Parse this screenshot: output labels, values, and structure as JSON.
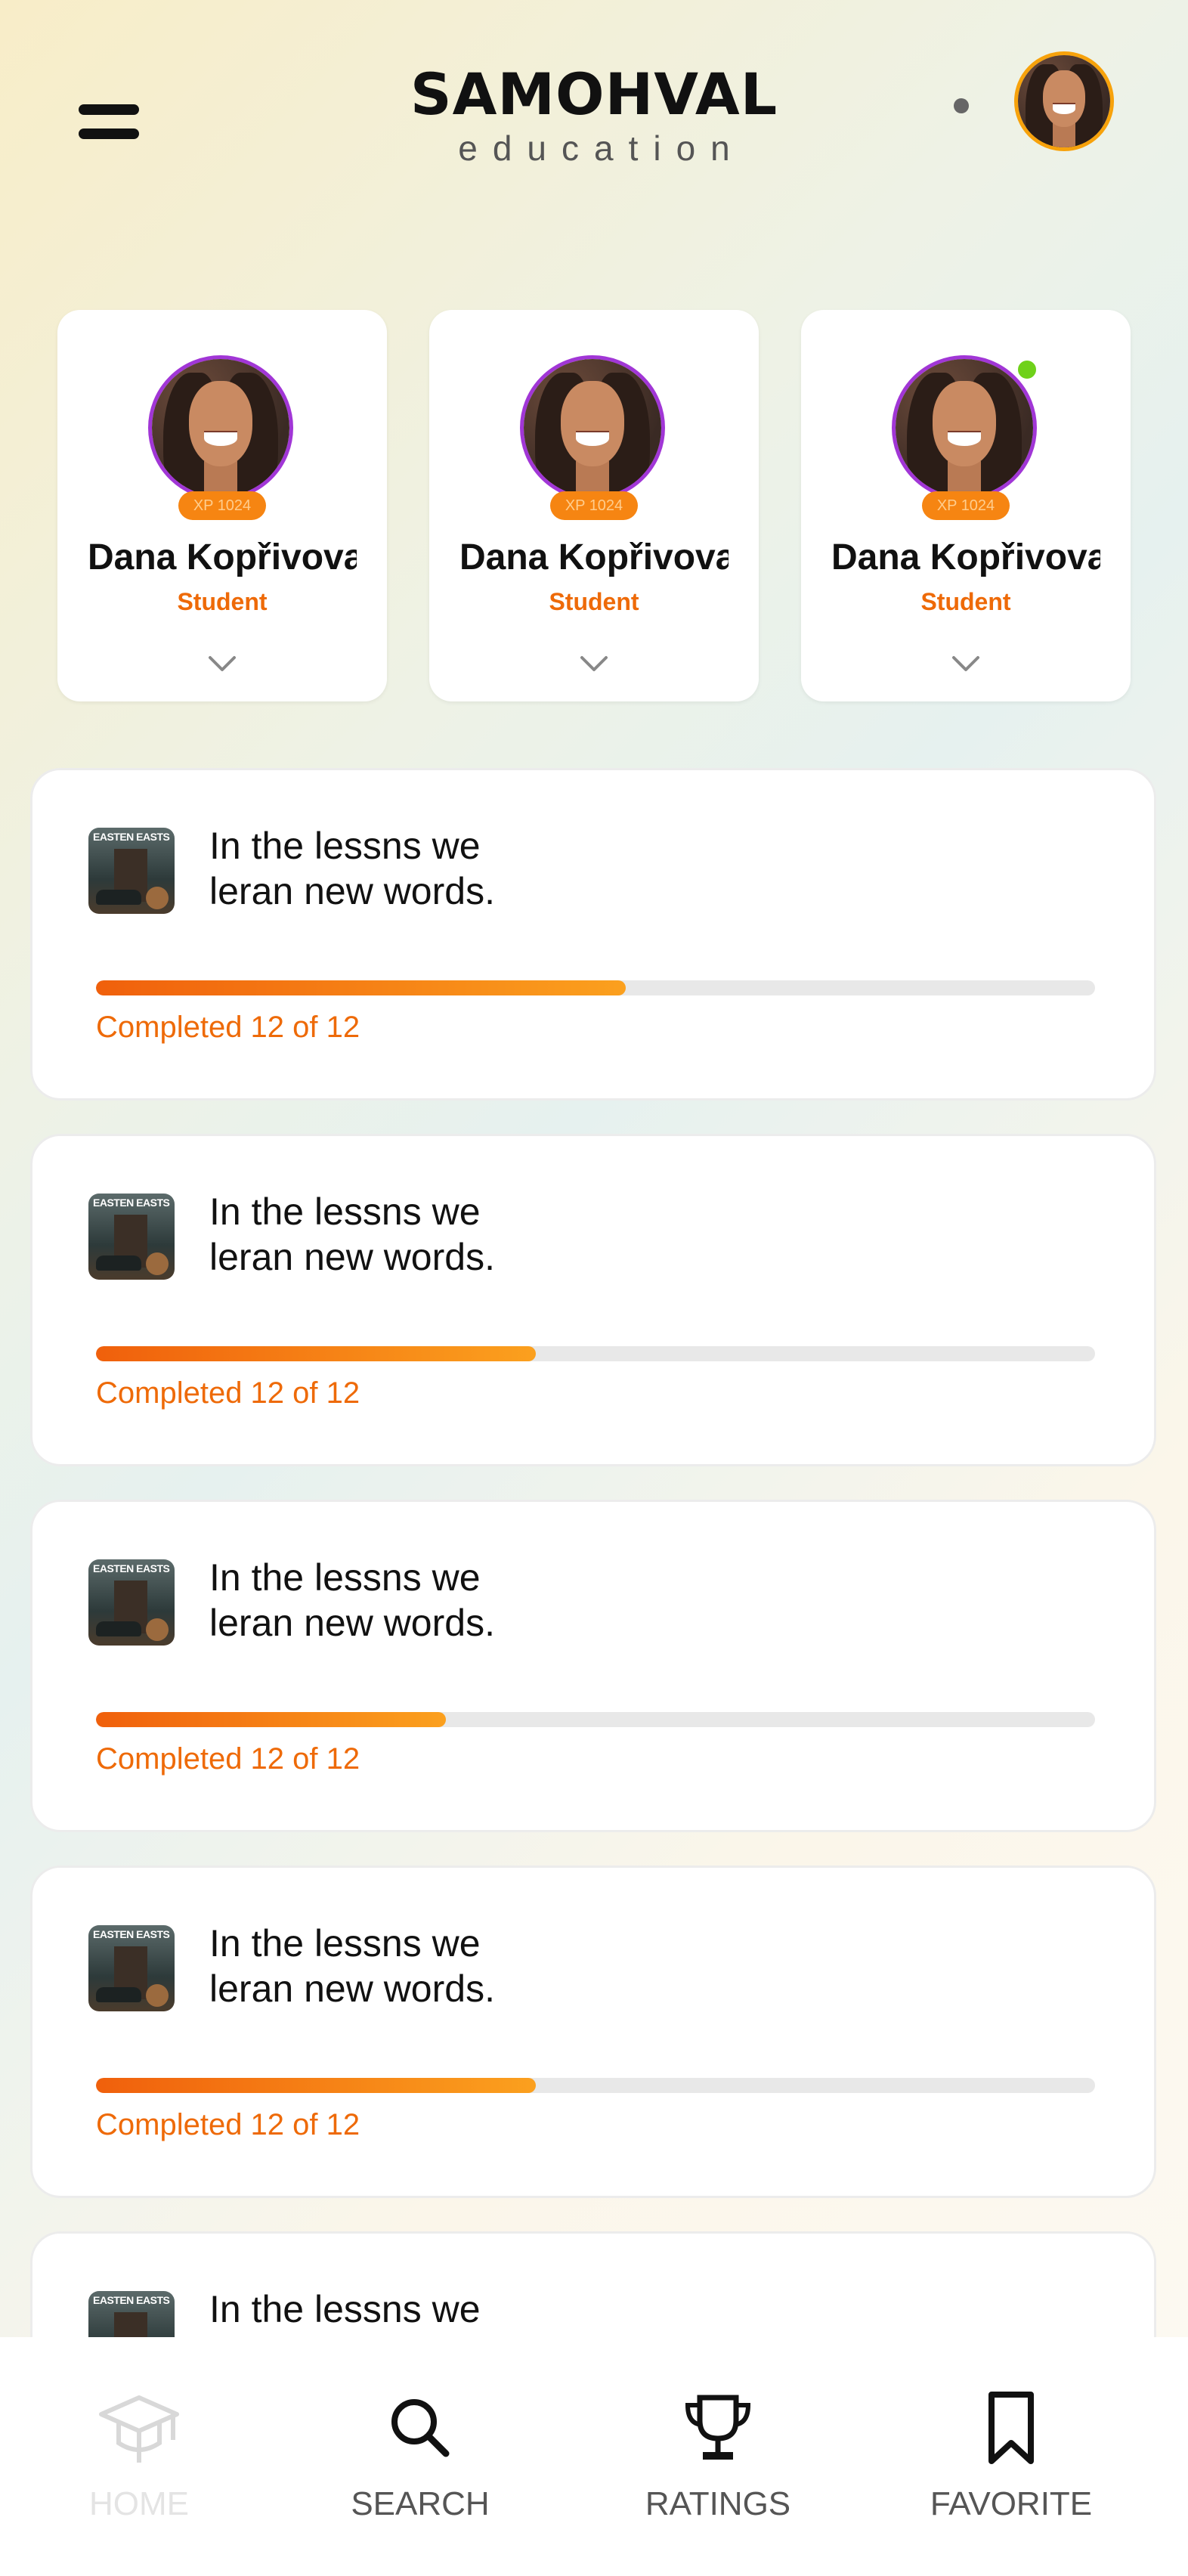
{
  "header": {
    "brand_name": "SAMOHVAL",
    "brand_sub": "education"
  },
  "profiles": [
    {
      "name": "Dana Kopřivova",
      "role": "Student",
      "xp": "XP 1024",
      "online": false
    },
    {
      "name": "Dana Kopřivova",
      "role": "Student",
      "xp": "XP 1024",
      "online": false
    },
    {
      "name": "Dana Kopřivova",
      "role": "Student",
      "xp": "XP 1024",
      "online": true
    }
  ],
  "lessons": [
    {
      "thumb_label": "EASTEN EASTSON",
      "line1": "In the lessns we",
      "line2": "leran new words.",
      "progress_text": "Completed 12 of 12",
      "progress": 0.53
    },
    {
      "thumb_label": "EASTEN EASTSON",
      "line1": "In the lessns we",
      "line2": "leran new words.",
      "progress_text": "Completed 12 of 12",
      "progress": 0.44
    },
    {
      "thumb_label": "EASTEN EASTSON",
      "line1": "In the lessns we",
      "line2": "leran new words.",
      "progress_text": "Completed 12 of 12",
      "progress": 0.35
    },
    {
      "thumb_label": "EASTEN EASTSON",
      "line1": "In the lessns we",
      "line2": "leran new words.",
      "progress_text": "Completed 12 of 12",
      "progress": 0.44
    },
    {
      "thumb_label": "EASTEN EASTSON",
      "line1": "In the lessns we",
      "line2": "",
      "progress_text": "",
      "progress": 0
    }
  ],
  "nav": [
    {
      "label": "HOME",
      "icon": "graduation-cap-icon",
      "active": false
    },
    {
      "label": "SEARCH",
      "icon": "search-icon",
      "active": true
    },
    {
      "label": "RATINGS",
      "icon": "trophy-icon",
      "active": true
    },
    {
      "label": "FAVORITE",
      "icon": "bookmark-icon",
      "active": true
    }
  ],
  "colors": {
    "accent": "#ee6a08",
    "avatar_ring": "#a136d6",
    "online": "#6fd11a"
  }
}
